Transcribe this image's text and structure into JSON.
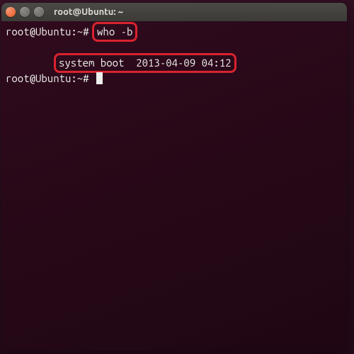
{
  "titlebar": {
    "title": "root@Ubuntu: ~"
  },
  "terminal": {
    "prompt1_prefix": "root@Ubuntu:~#",
    "command1": "who -b",
    "output_label": "system boot",
    "output_value": "2013-04-09 04:12",
    "prompt2_prefix": "root@Ubuntu:~#"
  },
  "icons": {
    "close": "×",
    "min": "−",
    "max": "▢"
  },
  "colors": {
    "highlight_border": "#d9232e",
    "titlebar_bg": "#3c3b37",
    "terminal_bg": "#2c0a1d",
    "text": "#eeeeec",
    "close_btn": "#e95420"
  }
}
